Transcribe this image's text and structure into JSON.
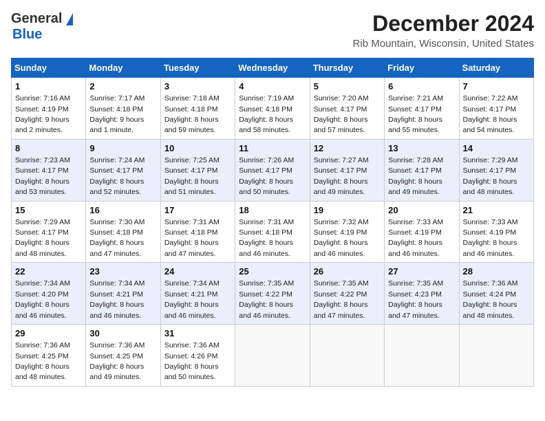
{
  "header": {
    "logo_line1": "General",
    "logo_line2": "Blue",
    "month": "December 2024",
    "location": "Rib Mountain, Wisconsin, United States"
  },
  "columns": [
    "Sunday",
    "Monday",
    "Tuesday",
    "Wednesday",
    "Thursday",
    "Friday",
    "Saturday"
  ],
  "weeks": [
    [
      {
        "day": "1",
        "sunrise": "7:16 AM",
        "sunset": "4:19 PM",
        "daylight": "9 hours and 2 minutes."
      },
      {
        "day": "2",
        "sunrise": "7:17 AM",
        "sunset": "4:18 PM",
        "daylight": "9 hours and 1 minute."
      },
      {
        "day": "3",
        "sunrise": "7:18 AM",
        "sunset": "4:18 PM",
        "daylight": "8 hours and 59 minutes."
      },
      {
        "day": "4",
        "sunrise": "7:19 AM",
        "sunset": "4:18 PM",
        "daylight": "8 hours and 58 minutes."
      },
      {
        "day": "5",
        "sunrise": "7:20 AM",
        "sunset": "4:17 PM",
        "daylight": "8 hours and 57 minutes."
      },
      {
        "day": "6",
        "sunrise": "7:21 AM",
        "sunset": "4:17 PM",
        "daylight": "8 hours and 55 minutes."
      },
      {
        "day": "7",
        "sunrise": "7:22 AM",
        "sunset": "4:17 PM",
        "daylight": "8 hours and 54 minutes."
      }
    ],
    [
      {
        "day": "8",
        "sunrise": "7:23 AM",
        "sunset": "4:17 PM",
        "daylight": "8 hours and 53 minutes."
      },
      {
        "day": "9",
        "sunrise": "7:24 AM",
        "sunset": "4:17 PM",
        "daylight": "8 hours and 52 minutes."
      },
      {
        "day": "10",
        "sunrise": "7:25 AM",
        "sunset": "4:17 PM",
        "daylight": "8 hours and 51 minutes."
      },
      {
        "day": "11",
        "sunrise": "7:26 AM",
        "sunset": "4:17 PM",
        "daylight": "8 hours and 50 minutes."
      },
      {
        "day": "12",
        "sunrise": "7:27 AM",
        "sunset": "4:17 PM",
        "daylight": "8 hours and 49 minutes."
      },
      {
        "day": "13",
        "sunrise": "7:28 AM",
        "sunset": "4:17 PM",
        "daylight": "8 hours and 49 minutes."
      },
      {
        "day": "14",
        "sunrise": "7:29 AM",
        "sunset": "4:17 PM",
        "daylight": "8 hours and 48 minutes."
      }
    ],
    [
      {
        "day": "15",
        "sunrise": "7:29 AM",
        "sunset": "4:17 PM",
        "daylight": "8 hours and 48 minutes."
      },
      {
        "day": "16",
        "sunrise": "7:30 AM",
        "sunset": "4:18 PM",
        "daylight": "8 hours and 47 minutes."
      },
      {
        "day": "17",
        "sunrise": "7:31 AM",
        "sunset": "4:18 PM",
        "daylight": "8 hours and 47 minutes."
      },
      {
        "day": "18",
        "sunrise": "7:31 AM",
        "sunset": "4:18 PM",
        "daylight": "8 hours and 46 minutes."
      },
      {
        "day": "19",
        "sunrise": "7:32 AM",
        "sunset": "4:19 PM",
        "daylight": "8 hours and 46 minutes."
      },
      {
        "day": "20",
        "sunrise": "7:33 AM",
        "sunset": "4:19 PM",
        "daylight": "8 hours and 46 minutes."
      },
      {
        "day": "21",
        "sunrise": "7:33 AM",
        "sunset": "4:19 PM",
        "daylight": "8 hours and 46 minutes."
      }
    ],
    [
      {
        "day": "22",
        "sunrise": "7:34 AM",
        "sunset": "4:20 PM",
        "daylight": "8 hours and 46 minutes."
      },
      {
        "day": "23",
        "sunrise": "7:34 AM",
        "sunset": "4:21 PM",
        "daylight": "8 hours and 46 minutes."
      },
      {
        "day": "24",
        "sunrise": "7:34 AM",
        "sunset": "4:21 PM",
        "daylight": "8 hours and 46 minutes."
      },
      {
        "day": "25",
        "sunrise": "7:35 AM",
        "sunset": "4:22 PM",
        "daylight": "8 hours and 46 minutes."
      },
      {
        "day": "26",
        "sunrise": "7:35 AM",
        "sunset": "4:22 PM",
        "daylight": "8 hours and 47 minutes."
      },
      {
        "day": "27",
        "sunrise": "7:35 AM",
        "sunset": "4:23 PM",
        "daylight": "8 hours and 47 minutes."
      },
      {
        "day": "28",
        "sunrise": "7:36 AM",
        "sunset": "4:24 PM",
        "daylight": "8 hours and 48 minutes."
      }
    ],
    [
      {
        "day": "29",
        "sunrise": "7:36 AM",
        "sunset": "4:25 PM",
        "daylight": "8 hours and 48 minutes."
      },
      {
        "day": "30",
        "sunrise": "7:36 AM",
        "sunset": "4:25 PM",
        "daylight": "8 hours and 49 minutes."
      },
      {
        "day": "31",
        "sunrise": "7:36 AM",
        "sunset": "4:26 PM",
        "daylight": "8 hours and 50 minutes."
      },
      null,
      null,
      null,
      null
    ]
  ]
}
